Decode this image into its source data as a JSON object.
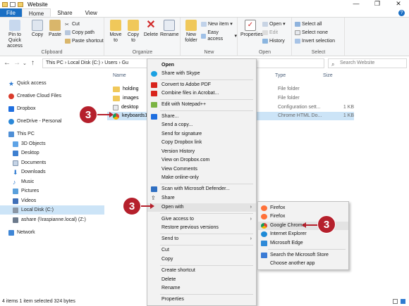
{
  "window": {
    "title": "Website",
    "controls": [
      "—",
      "❐",
      "✕"
    ]
  },
  "ribbon_tabs": [
    "File",
    "Home",
    "Share",
    "View"
  ],
  "ribbon": {
    "clipboard": {
      "label": "Clipboard",
      "pin": "Pin to Quick access",
      "copy": "Copy",
      "paste": "Paste",
      "cut": "Cut",
      "copy_path": "Copy path",
      "paste_shortcut": "Paste shortcut"
    },
    "organize": {
      "label": "Organize",
      "move_to": "Move to",
      "copy_to": "Copy to",
      "delete": "Delete",
      "rename": "Rename"
    },
    "new": {
      "label": "New",
      "new_folder": "New folder",
      "new_item": "New item",
      "easy_access": "Easy access"
    },
    "open": {
      "label": "Open",
      "properties": "Properties",
      "open": "Open",
      "edit": "Edit",
      "history": "History"
    },
    "select": {
      "label": "Select",
      "select_all": "Select all",
      "select_none": "Select none",
      "invert": "Invert selection"
    }
  },
  "address": {
    "path": "This PC  ›  Local Disk (C:)  ›  Users  ›  Gu",
    "search_placeholder": "Search Website"
  },
  "sidebar": {
    "items": [
      "Quick access",
      "Creative Cloud Files",
      "Dropbox",
      "OneDrive - Personal",
      "This PC",
      "3D Objects",
      "Desktop",
      "Documents",
      "Downloads",
      "Music",
      "Pictures",
      "Videos",
      "Local Disk (C:)",
      "ashare (\\\\raspianne.local) (Z:)",
      "Network"
    ]
  },
  "columns": {
    "name": "Name",
    "type": "Type",
    "size": "Size"
  },
  "files": [
    {
      "name": "holding",
      "type": "File folder",
      "size": ""
    },
    {
      "name": "images",
      "type": "File folder",
      "size": ""
    },
    {
      "name": "desktop",
      "type": "Configuration sett...",
      "size": "1 KB"
    },
    {
      "name": "keyboards1",
      "type": "Chrome HTML Do...",
      "size": "1 KB"
    }
  ],
  "status": "4 items     1 item selected  324 bytes",
  "context_menu": [
    "Open",
    "Share with Skype",
    "Convert to Adobe PDF",
    "Combine files in Acrobat...",
    "Edit with Notepad++",
    "Share...",
    "Send a copy...",
    "Send for signature",
    "Copy Dropbox link",
    "Version History",
    "View on Dropbox.com",
    "View Comments",
    "Make online-only",
    "Scan with Microsoft Defender...",
    "Share",
    "Open with",
    "Give access to",
    "Restore previous versions",
    "Send to",
    "Cut",
    "Copy",
    "Create shortcut",
    "Delete",
    "Rename",
    "Properties"
  ],
  "open_with_menu": [
    "Firefox",
    "Firefox",
    "Google Chrome",
    "Internet Explorer",
    "Microsoft Edge",
    "Search the Microsoft Store",
    "Choose another app"
  ],
  "callouts": [
    "3",
    "3",
    "3"
  ],
  "colors": {
    "accent": "#1a6fc4",
    "callout": "#b5202c",
    "selection": "#cce4f7"
  }
}
